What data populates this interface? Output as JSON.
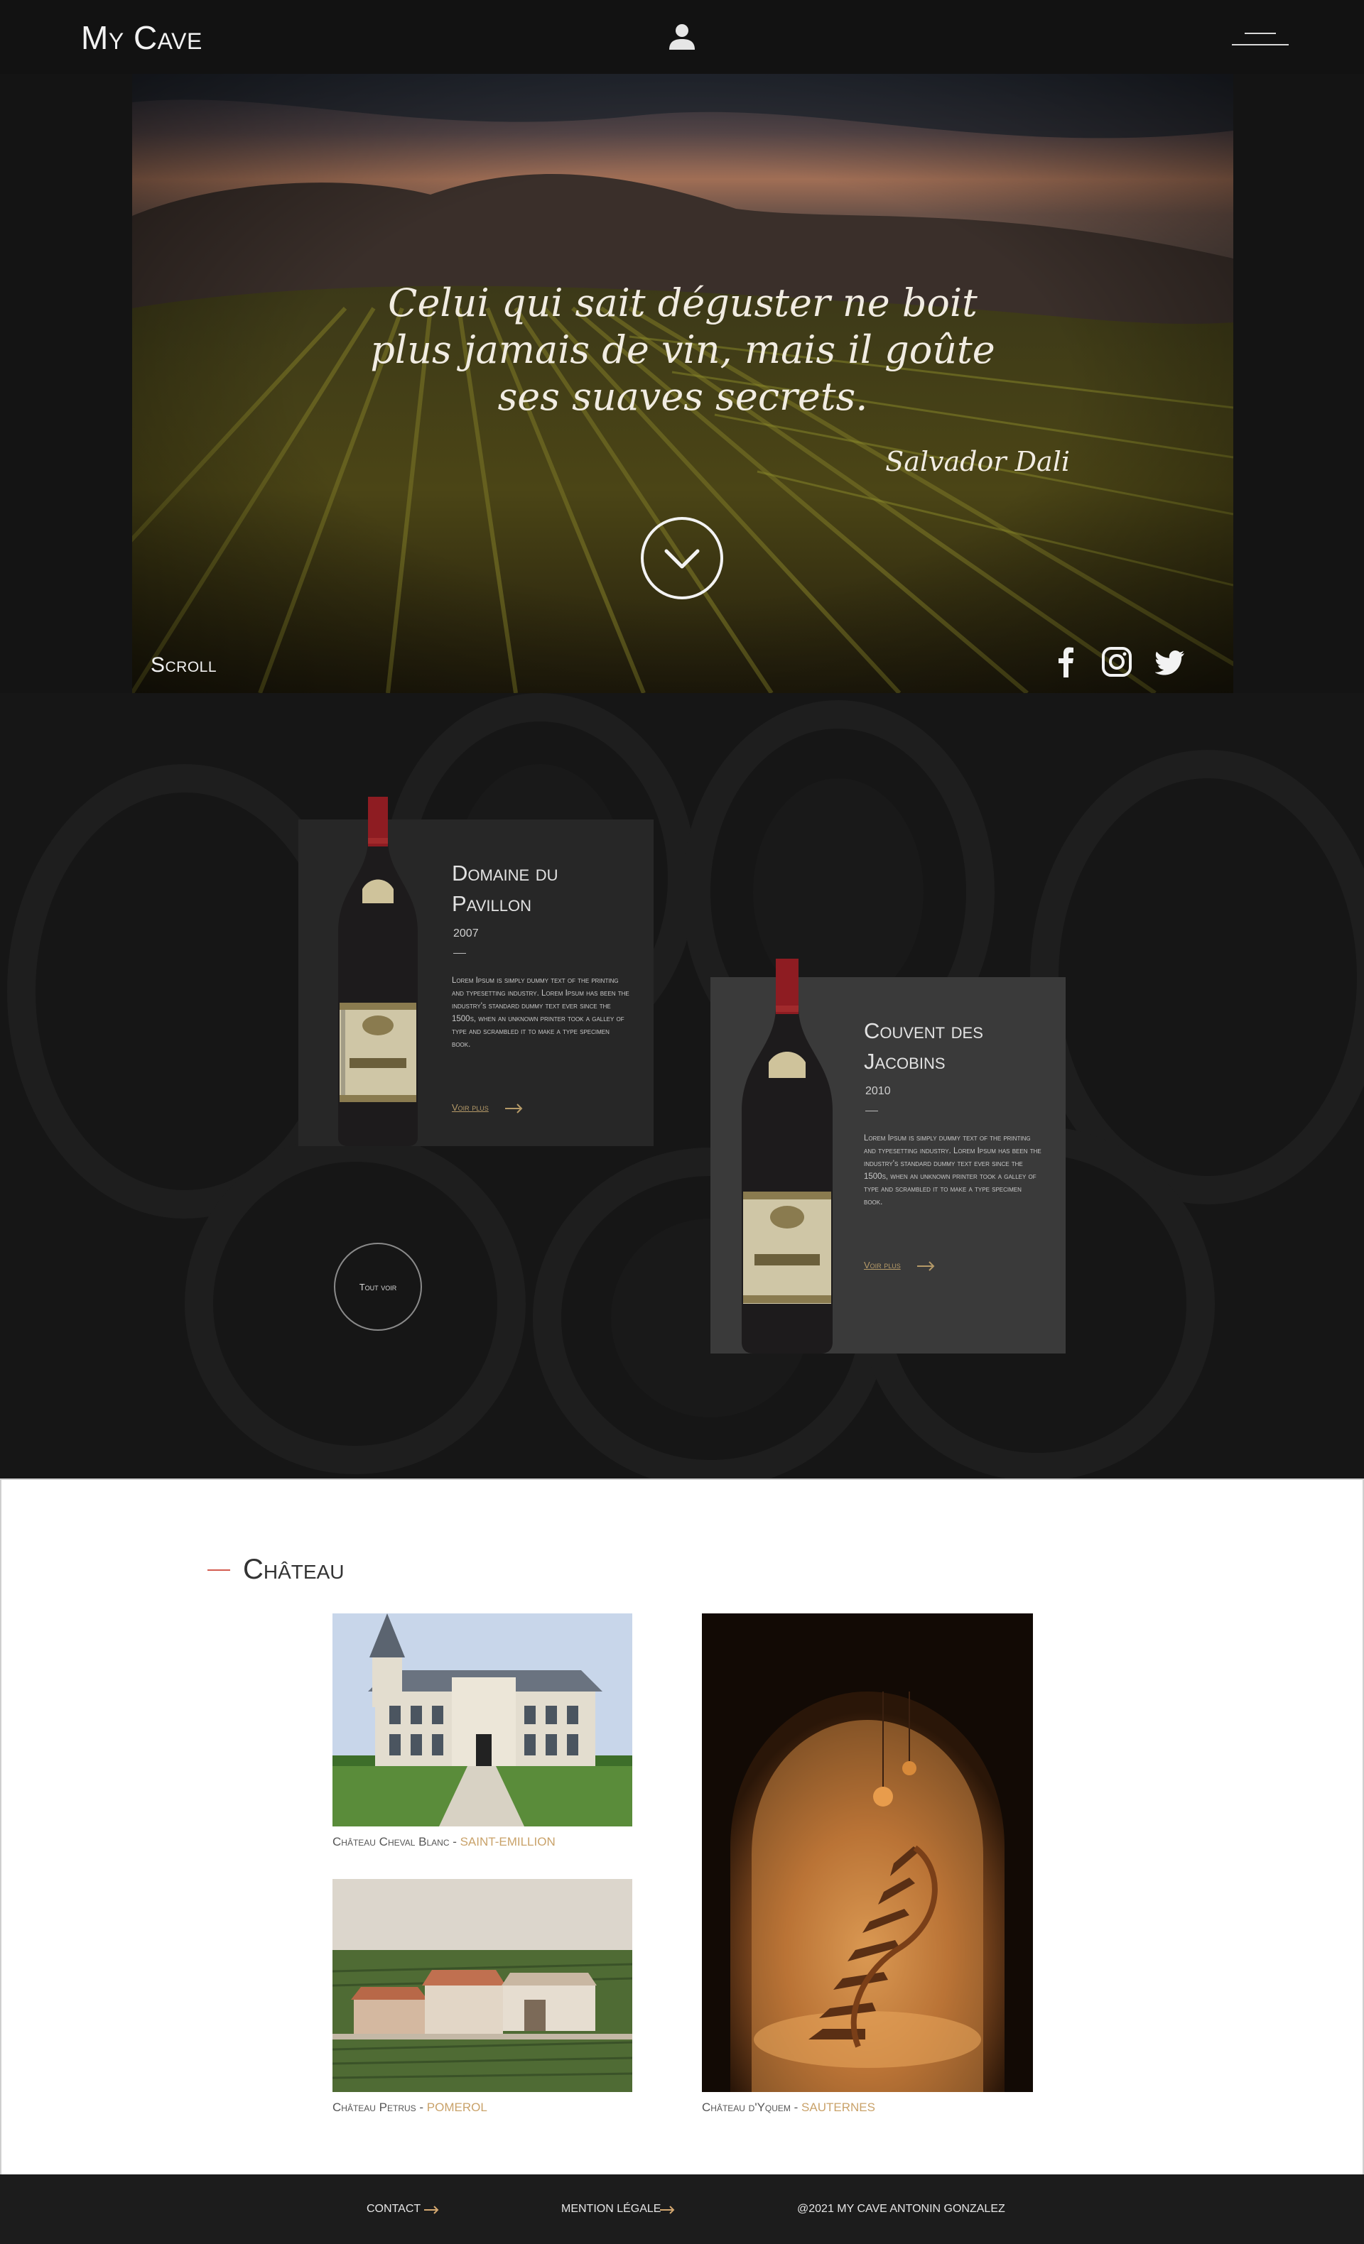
{
  "header": {
    "logo": "My Cave"
  },
  "hero": {
    "quote": "Celui qui sait déguster ne boit plus jamais de vin, mais il goûte ses suaves secrets.",
    "author": "Salvador Dali",
    "scroll_label": "Scroll",
    "social": [
      "facebook-icon",
      "instagram-icon",
      "twitter-icon"
    ]
  },
  "wines": {
    "items": [
      {
        "name": "Domaine du Pavillon",
        "year": "2007",
        "description": "Lorem Ipsum is simply dummy text of the printing and typesetting industry. Lorem Ipsum has been the industry's standard dummy text ever since the 1500s, when an unknown printer took a galley of type and scrambled it to make a type specimen book.",
        "link": "Voir plus"
      },
      {
        "name": "Couvent des Jacobins",
        "year": "2010",
        "description": "Lorem Ipsum is simply dummy text of the printing and typesetting industry. Lorem Ipsum has been the industry's standard dummy text ever since the 1500s, when an unknown printer took a galley of type and scrambled it to make a type specimen book.",
        "link": "Voir plus"
      }
    ],
    "see_all": "Tout voir"
  },
  "chateau": {
    "title": "Château",
    "items": [
      {
        "name": "Château Cheval Blanc",
        "separator": " - ",
        "region": "SAINT-EMILLION"
      },
      {
        "name": "Château Petrus",
        "separator": " - ",
        "region": "POMEROL"
      },
      {
        "name": "Château d'Yquem",
        "separator": " - ",
        "region": "SAUTERNES"
      }
    ]
  },
  "footer": {
    "contact": "CONTACT",
    "legal": "MENTION LÉGALE",
    "copyright": "@2021 MY CAVE ANTONIN GONZALEZ"
  },
  "colors": {
    "accent_gold": "#c9a26a",
    "accent_red": "#d45c50",
    "background_dark": "#141414"
  }
}
